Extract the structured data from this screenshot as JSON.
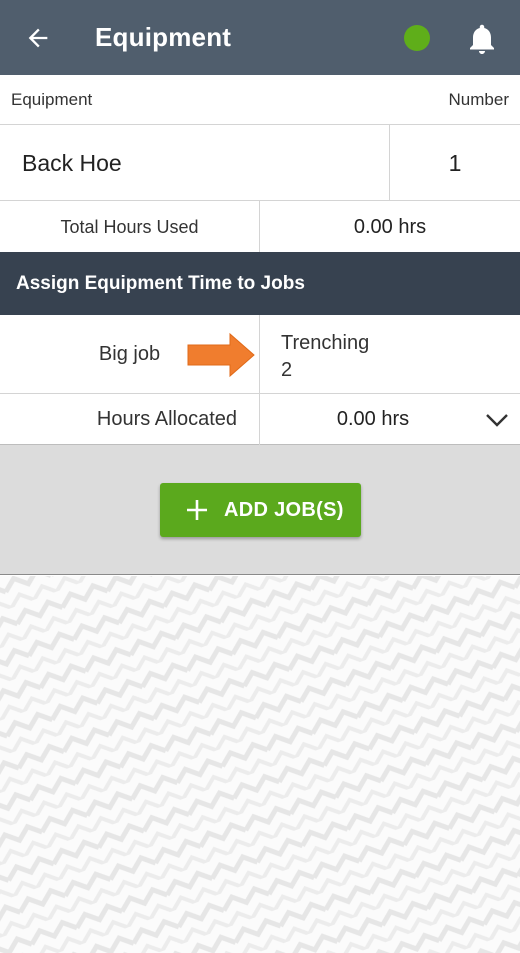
{
  "header": {
    "title": "Equipment",
    "status_color": "#5fae1a",
    "back_icon": "back-arrow-icon",
    "notifications_icon": "bell-icon"
  },
  "table_header": {
    "left": "Equipment",
    "right": "Number"
  },
  "equipment": {
    "name": "Back Hoe",
    "number": "1"
  },
  "total": {
    "label": "Total Hours Used",
    "value": "0.00 hrs"
  },
  "section": {
    "title": "Assign Equipment Time to Jobs"
  },
  "job": {
    "name": "Big job",
    "task": "Trenching",
    "task_number": "2",
    "pointer_icon": "orange-arrow-icon"
  },
  "allocation": {
    "label": "Hours Allocated",
    "value": "0.00 hrs"
  },
  "actions": {
    "add_label": "ADD JOB(S)",
    "add_color": "#5ba91d"
  }
}
